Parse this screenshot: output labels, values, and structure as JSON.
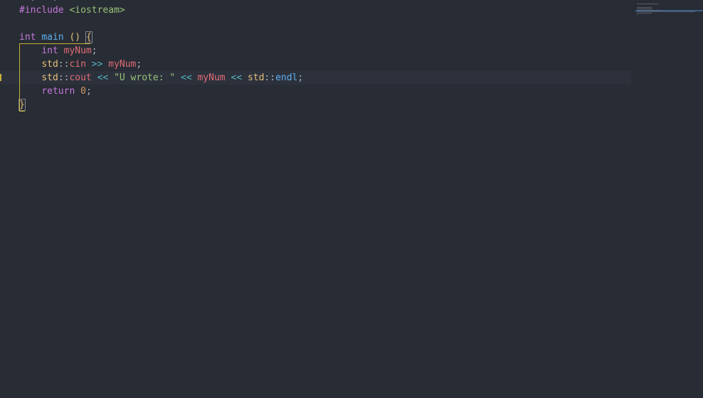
{
  "editor": {
    "language": "cpp",
    "top_partial_line": "  ,   ,        ",
    "lines": [
      {
        "tokens": [
          {
            "t": "#include",
            "c": "kw"
          },
          {
            "t": " ",
            "c": "pun"
          },
          {
            "t": "<iostream>",
            "c": "inc"
          }
        ]
      },
      {
        "tokens": []
      },
      {
        "tokens": [
          {
            "t": "int",
            "c": "kw"
          },
          {
            "t": " ",
            "c": "pun"
          },
          {
            "t": "main",
            "c": "fn"
          },
          {
            "t": " ",
            "c": "pun"
          },
          {
            "t": "()",
            "c": "brace"
          },
          {
            "t": " ",
            "c": "pun"
          },
          {
            "t": "{",
            "c": "brace"
          }
        ]
      },
      {
        "tokens": [
          {
            "t": "    ",
            "c": "pun"
          },
          {
            "t": "int",
            "c": "kw"
          },
          {
            "t": " ",
            "c": "pun"
          },
          {
            "t": "myNum",
            "c": "var"
          },
          {
            "t": ";",
            "c": "pun"
          }
        ]
      },
      {
        "tokens": [
          {
            "t": "    ",
            "c": "pun"
          },
          {
            "t": "std",
            "c": "ns"
          },
          {
            "t": "::",
            "c": "pun"
          },
          {
            "t": "cin",
            "c": "var"
          },
          {
            "t": " ",
            "c": "pun"
          },
          {
            "t": ">>",
            "c": "op"
          },
          {
            "t": " ",
            "c": "pun"
          },
          {
            "t": "myNum",
            "c": "var"
          },
          {
            "t": ";",
            "c": "pun"
          }
        ]
      },
      {
        "tokens": [
          {
            "t": "    ",
            "c": "pun"
          },
          {
            "t": "std",
            "c": "ns"
          },
          {
            "t": "::",
            "c": "pun"
          },
          {
            "t": "cout",
            "c": "var"
          },
          {
            "t": " ",
            "c": "pun"
          },
          {
            "t": "<<",
            "c": "op"
          },
          {
            "t": " ",
            "c": "pun"
          },
          {
            "t": "\"U wrote: \"",
            "c": "str"
          },
          {
            "t": " ",
            "c": "pun"
          },
          {
            "t": "<<",
            "c": "op"
          },
          {
            "t": " ",
            "c": "pun"
          },
          {
            "t": "myNum",
            "c": "var"
          },
          {
            "t": " ",
            "c": "pun"
          },
          {
            "t": "<<",
            "c": "op"
          },
          {
            "t": " ",
            "c": "pun"
          },
          {
            "t": "std",
            "c": "ns"
          },
          {
            "t": "::",
            "c": "pun"
          },
          {
            "t": "endl",
            "c": "fn"
          },
          {
            "t": ";",
            "c": "pun"
          }
        ]
      },
      {
        "tokens": [
          {
            "t": "    ",
            "c": "pun"
          },
          {
            "t": "return",
            "c": "kw"
          },
          {
            "t": " ",
            "c": "pun"
          },
          {
            "t": "0",
            "c": "num"
          },
          {
            "t": ";",
            "c": "pun"
          }
        ]
      },
      {
        "tokens": [
          {
            "t": "}",
            "c": "brace"
          }
        ]
      }
    ]
  },
  "colors": {
    "background": "#282c34",
    "current_line": "#2c313c",
    "bracket_guide": "#c9b035"
  }
}
